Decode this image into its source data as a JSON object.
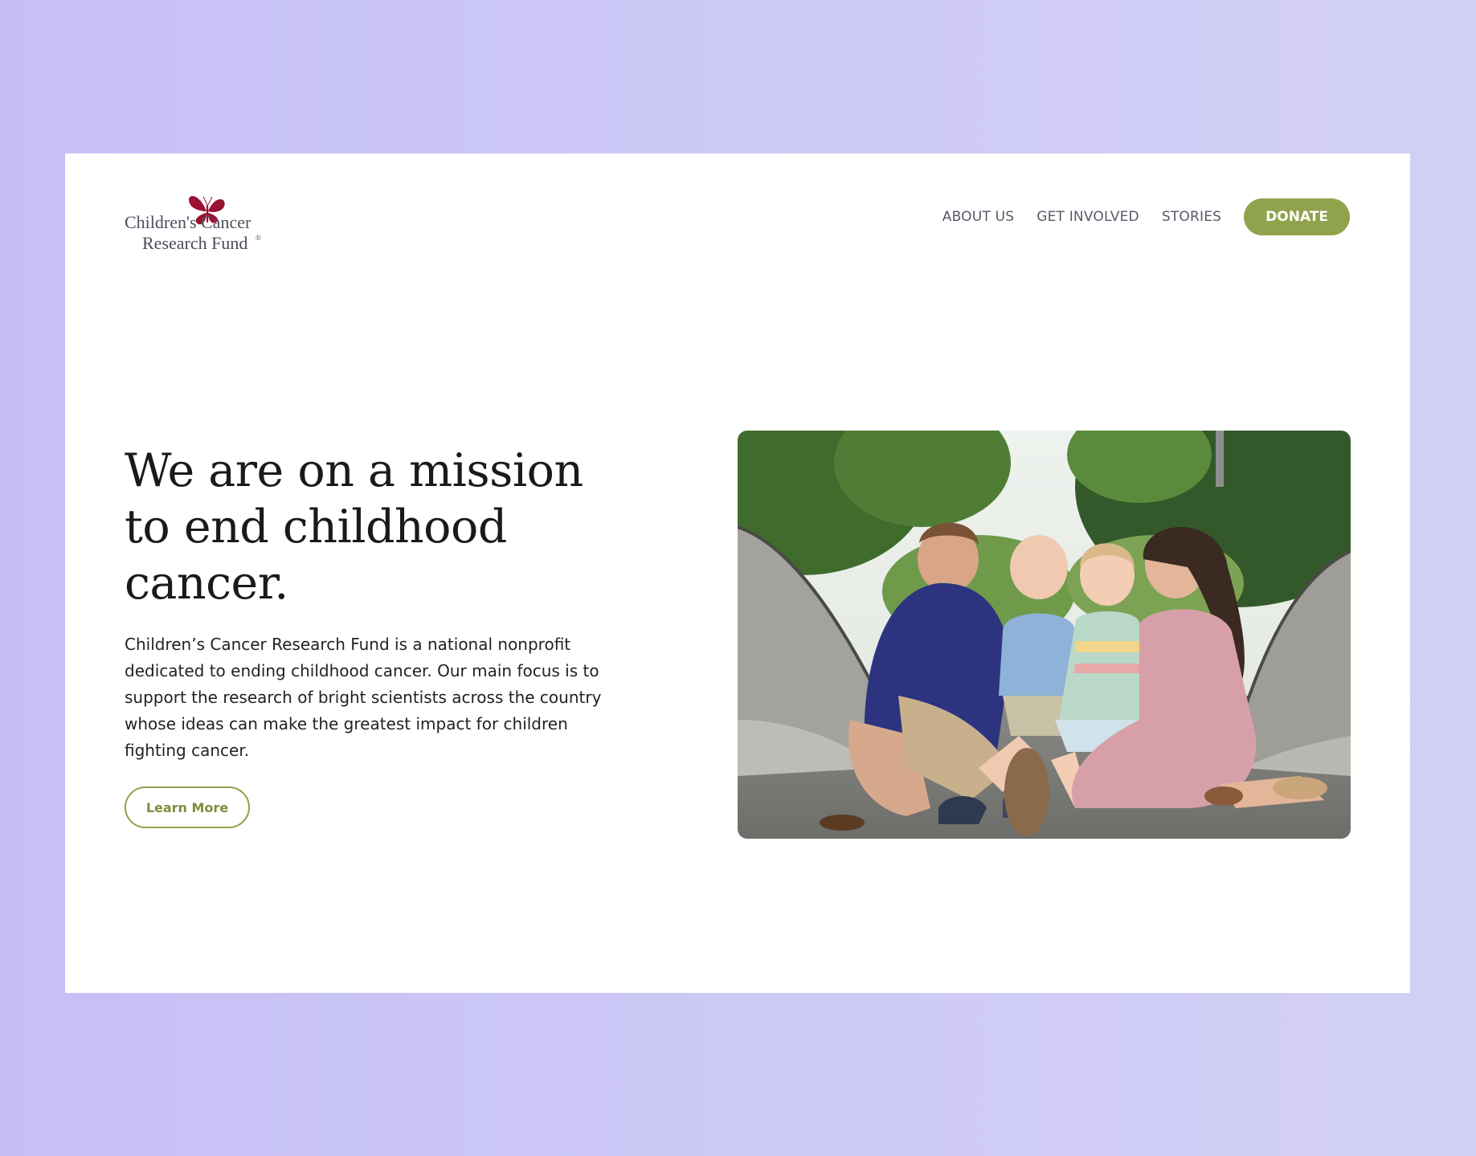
{
  "header": {
    "logo": {
      "line1": "Children's Cancer",
      "line2": "Research Fund",
      "registered_mark": "®",
      "icon": "butterfly-icon",
      "brand_color": "#9b1133"
    },
    "nav": {
      "items": [
        {
          "label": "ABOUT US"
        },
        {
          "label": "GET INVOLVED"
        },
        {
          "label": "STORIES"
        }
      ],
      "donate_label": "DONATE"
    }
  },
  "hero": {
    "heading": "We are on a mission to end childhood cancer.",
    "body": "Children’s Cancer Research Fund is a national nonprofit dedicated to ending childhood cancer. Our main focus is to support the research of bright scientists across the country whose ideas can make the greatest impact for children fighting cancer.",
    "cta_label": "Learn More",
    "image": {
      "subject": "family-photo"
    }
  },
  "colors": {
    "background_left": "#c6bff7",
    "background_right": "#d3d0f6",
    "accent_green": "#90a24b",
    "text_dark": "#1a1a1a",
    "nav_text": "#555a66"
  }
}
